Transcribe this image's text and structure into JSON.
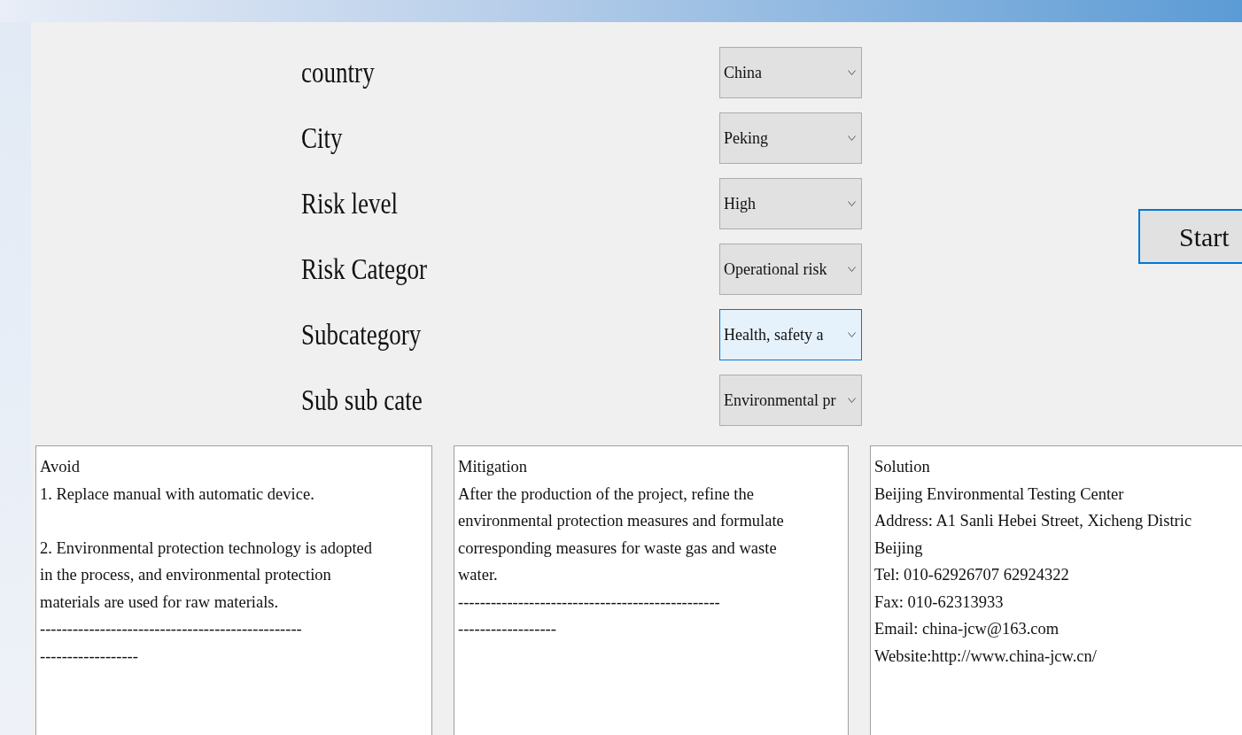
{
  "form": {
    "fields": [
      {
        "label": "country",
        "value": "China",
        "focused": false
      },
      {
        "label": "City",
        "value": "Peking",
        "focused": false
      },
      {
        "label": "Risk level",
        "value": "High",
        "focused": false
      },
      {
        "label": "Risk Categor",
        "value": "Operational risk",
        "focused": false
      },
      {
        "label": "Subcategory",
        "value": "Health, safety a",
        "focused": true
      },
      {
        "label": "Sub sub cate",
        "value": "Environmental pr",
        "focused": false
      }
    ]
  },
  "start_button": {
    "label": "Start",
    "focused": true
  },
  "panels": [
    {
      "lines": [
        "Avoid",
        "1. Replace manual with automatic device.",
        "2. Environmental protection technology is adopted",
        "in the process, and environmental protection",
        "materials are used for raw materials.",
        "------------------------------------------------",
        "------------------"
      ],
      "spaced_before": [
        false,
        false,
        true,
        false,
        false,
        false,
        false
      ]
    },
    {
      "lines": [
        "Mitigation",
        "After the production of the project, refine the",
        "environmental protection measures and formulate",
        "corresponding measures for waste gas and waste",
        "water.",
        "------------------------------------------------",
        "------------------"
      ]
    },
    {
      "lines": [
        "Solution",
        "Beijing Environmental Testing Center",
        "Address: A1 Sanli Hebei Street, Xicheng Distric",
        "Beijing",
        "Tel: 010-62926707 62924322",
        "Fax: 010-62313933",
        "Email: china-jcw@163.com",
        "Website:http://www.china-jcw.cn/"
      ]
    }
  ]
}
